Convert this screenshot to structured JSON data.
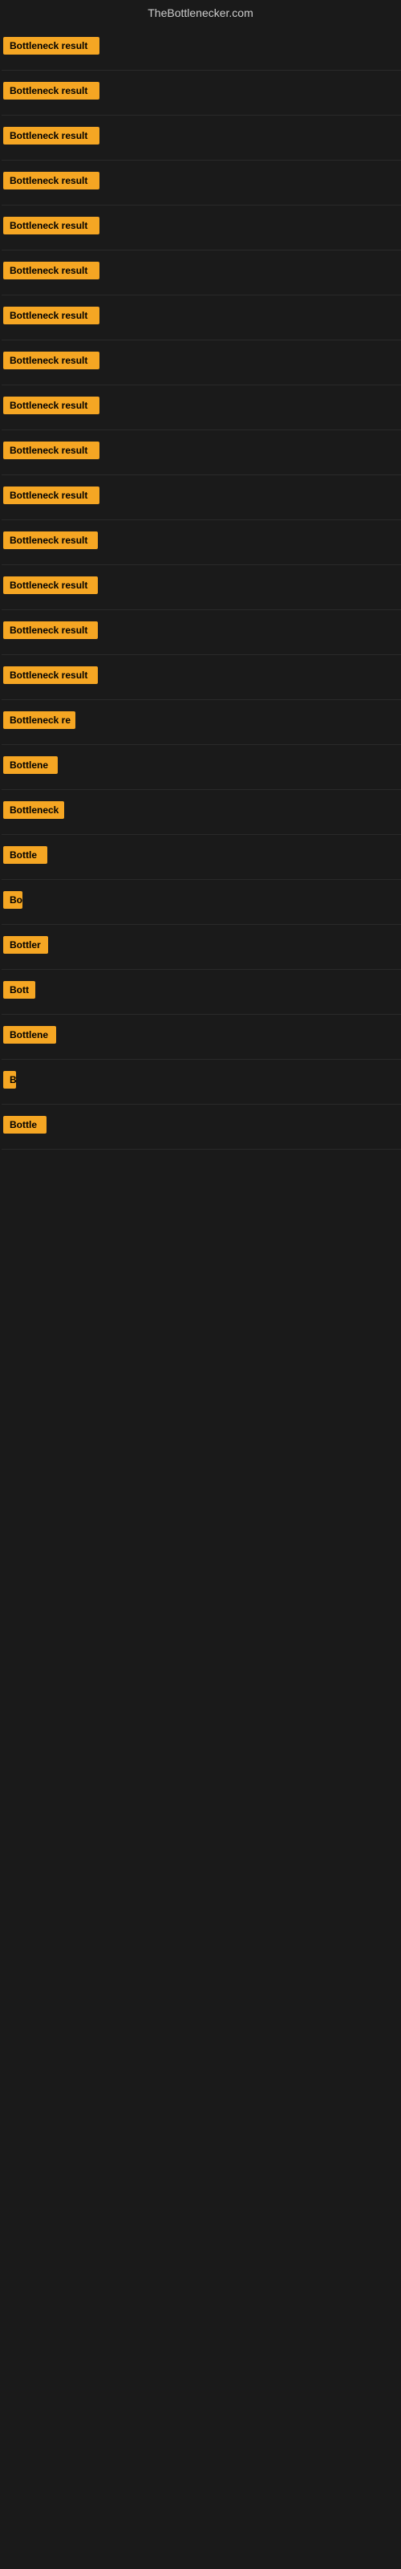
{
  "site": {
    "title": "TheBottlenecker.com"
  },
  "badges": [
    {
      "id": 1,
      "label": "Bottleneck result",
      "width": 120
    },
    {
      "id": 2,
      "label": "Bottleneck result",
      "width": 120
    },
    {
      "id": 3,
      "label": "Bottleneck result",
      "width": 120
    },
    {
      "id": 4,
      "label": "Bottleneck result",
      "width": 120
    },
    {
      "id": 5,
      "label": "Bottleneck result",
      "width": 120
    },
    {
      "id": 6,
      "label": "Bottleneck result",
      "width": 120
    },
    {
      "id": 7,
      "label": "Bottleneck result",
      "width": 120
    },
    {
      "id": 8,
      "label": "Bottleneck result",
      "width": 120
    },
    {
      "id": 9,
      "label": "Bottleneck result",
      "width": 120
    },
    {
      "id": 10,
      "label": "Bottleneck result",
      "width": 120
    },
    {
      "id": 11,
      "label": "Bottleneck result",
      "width": 120
    },
    {
      "id": 12,
      "label": "Bottleneck result",
      "width": 118
    },
    {
      "id": 13,
      "label": "Bottleneck result",
      "width": 118
    },
    {
      "id": 14,
      "label": "Bottleneck result",
      "width": 118
    },
    {
      "id": 15,
      "label": "Bottleneck result",
      "width": 118
    },
    {
      "id": 16,
      "label": "Bottleneck re",
      "width": 90
    },
    {
      "id": 17,
      "label": "Bottlene",
      "width": 68
    },
    {
      "id": 18,
      "label": "Bottleneck",
      "width": 76
    },
    {
      "id": 19,
      "label": "Bottle",
      "width": 55
    },
    {
      "id": 20,
      "label": "Bo",
      "width": 24
    },
    {
      "id": 21,
      "label": "Bottler",
      "width": 56
    },
    {
      "id": 22,
      "label": "Bott",
      "width": 40
    },
    {
      "id": 23,
      "label": "Bottlene",
      "width": 66
    },
    {
      "id": 24,
      "label": "B",
      "width": 16
    },
    {
      "id": 25,
      "label": "Bottle",
      "width": 54
    }
  ]
}
